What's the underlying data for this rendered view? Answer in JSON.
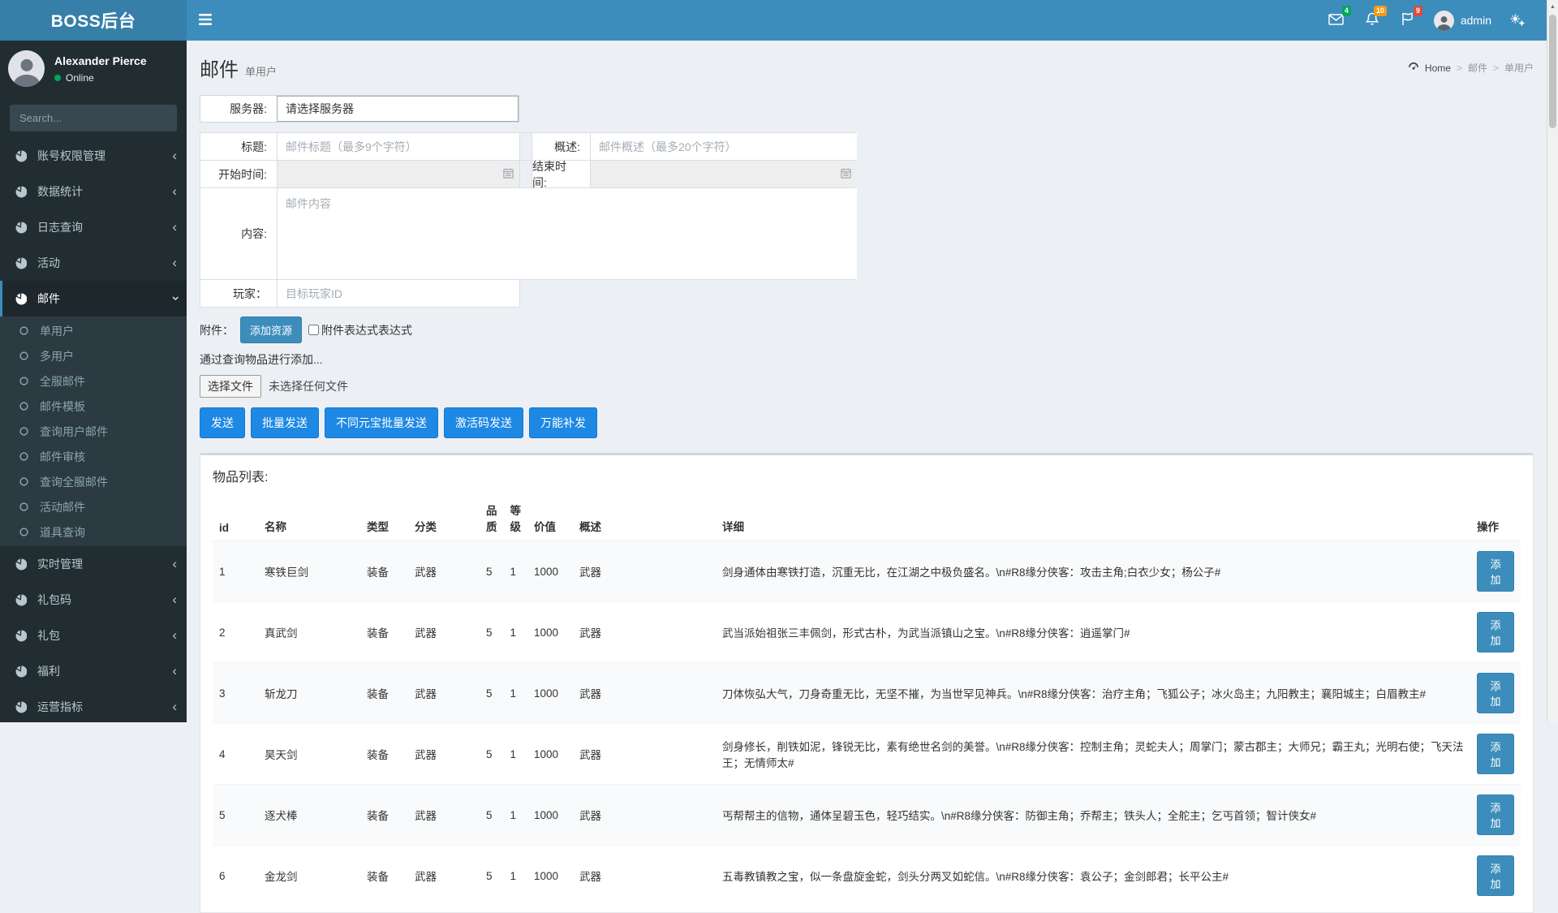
{
  "navbar": {
    "logo": "BOSS后台",
    "messages_badge": "4",
    "notifications_badge": "10",
    "tasks_badge": "9",
    "username": "admin"
  },
  "sidebar": {
    "user": {
      "name": "Alexander Pierce",
      "status": "Online"
    },
    "search_placeholder": "Search...",
    "menu": [
      {
        "label": "账号权限管理"
      },
      {
        "label": "数据统计"
      },
      {
        "label": "日志查询"
      },
      {
        "label": "活动"
      },
      {
        "label": "邮件",
        "active": true,
        "submenu": [
          "单用户",
          "多用户",
          "全服邮件",
          "邮件模板",
          "查询用户邮件",
          "邮件审核",
          "查询全服邮件",
          "活动邮件",
          "道具查询"
        ]
      },
      {
        "label": "实时管理"
      },
      {
        "label": "礼包码"
      },
      {
        "label": "礼包"
      },
      {
        "label": "福利"
      },
      {
        "label": "运营指标"
      }
    ]
  },
  "header": {
    "title": "邮件",
    "subtitle": "单用户",
    "breadcrumb": [
      "Home",
      "邮件",
      "单用户"
    ]
  },
  "form": {
    "server_label": "服务器:",
    "server_value": "请选择服务器",
    "title_label": "标题:",
    "title_placeholder": "邮件标题（最多9个字符）",
    "summary_label": "概述:",
    "summary_placeholder": "邮件概述（最多20个字符）",
    "start_label": "开始时间:",
    "end_label": "结束时间:",
    "content_label": "内容:",
    "content_placeholder": "邮件内容",
    "player_label": "玩家：",
    "player_placeholder": "目标玩家ID",
    "attachment_label": "附件：",
    "add_resource_button": "添加资源",
    "attachment_checkbox_label": "附件表达式表达式",
    "query_note": "通过查询物品进行添加...",
    "file_button": "选择文件",
    "file_status": "未选择任何文件",
    "action_buttons": [
      "发送",
      "批量发送",
      "不同元宝批量发送",
      "激活码发送",
      "万能补发"
    ]
  },
  "items_table": {
    "section_title": "物品列表:",
    "headers": [
      "id",
      "名称",
      "类型",
      "分类",
      "品质",
      "等级",
      "价值",
      "概述",
      "详细",
      "操作"
    ],
    "add_button_label": "添加",
    "rows": [
      {
        "id": "1",
        "name": "寒铁巨剑",
        "type": "装备",
        "category": "武器",
        "quality": "5",
        "level": "1",
        "value": "1000",
        "summary": "武器",
        "detail": "剑身通体由寒铁打造，沉重无比，在江湖之中极负盛名。\\n#R8缘分侠客：攻击主角;白衣少女；杨公子#"
      },
      {
        "id": "2",
        "name": "真武剑",
        "type": "装备",
        "category": "武器",
        "quality": "5",
        "level": "1",
        "value": "1000",
        "summary": "武器",
        "detail": "武当派始祖张三丰佩剑，形式古朴，为武当派镇山之宝。\\n#R8缘分侠客：逍遥掌门#"
      },
      {
        "id": "3",
        "name": "斩龙刀",
        "type": "装备",
        "category": "武器",
        "quality": "5",
        "level": "1",
        "value": "1000",
        "summary": "武器",
        "detail": "刀体恢弘大气，刀身奇重无比，无坚不摧，为当世罕见神兵。\\n#R8缘分侠客：治疗主角；飞狐公子；冰火岛主；九阳教主；襄阳城主；白眉教主#"
      },
      {
        "id": "4",
        "name": "昊天剑",
        "type": "装备",
        "category": "武器",
        "quality": "5",
        "level": "1",
        "value": "1000",
        "summary": "武器",
        "detail": "剑身修长，削铁如泥，锋锐无比，素有绝世名剑的美誉。\\n#R8缘分侠客：控制主角；灵蛇夫人；周掌门；蒙古郡主；大师兄；霸王丸；光明右使；飞天法王；无情师太#"
      },
      {
        "id": "5",
        "name": "逐犬棒",
        "type": "装备",
        "category": "武器",
        "quality": "5",
        "level": "1",
        "value": "1000",
        "summary": "武器",
        "detail": "丐帮帮主的信物，通体呈碧玉色，轻巧结实。\\n#R8缘分侠客：防御主角；乔帮主；铁头人；全舵主；乞丐首领；智计侠女#"
      },
      {
        "id": "6",
        "name": "金龙剑",
        "type": "装备",
        "category": "武器",
        "quality": "5",
        "level": "1",
        "value": "1000",
        "summary": "武器",
        "detail": "五毒教镇教之宝，似一条盘旋金蛇，剑头分两叉如蛇信。\\n#R8缘分侠客：袁公子；金剑郎君；长平公主#"
      }
    ]
  },
  "colors": {
    "navbar": "#3c8dbc",
    "logo_bg": "#367fa9",
    "sidebar_bg": "#222d32",
    "submenu_bg": "#2c3b41",
    "content_bg": "#ecf0f5",
    "badge_green": "#00a65a",
    "badge_yellow": "#f39c12",
    "badge_red": "#dd4b39",
    "primary_button": "#1e88e5",
    "muted_button": "#3c8dbc",
    "online_dot": "#00a65a"
  }
}
